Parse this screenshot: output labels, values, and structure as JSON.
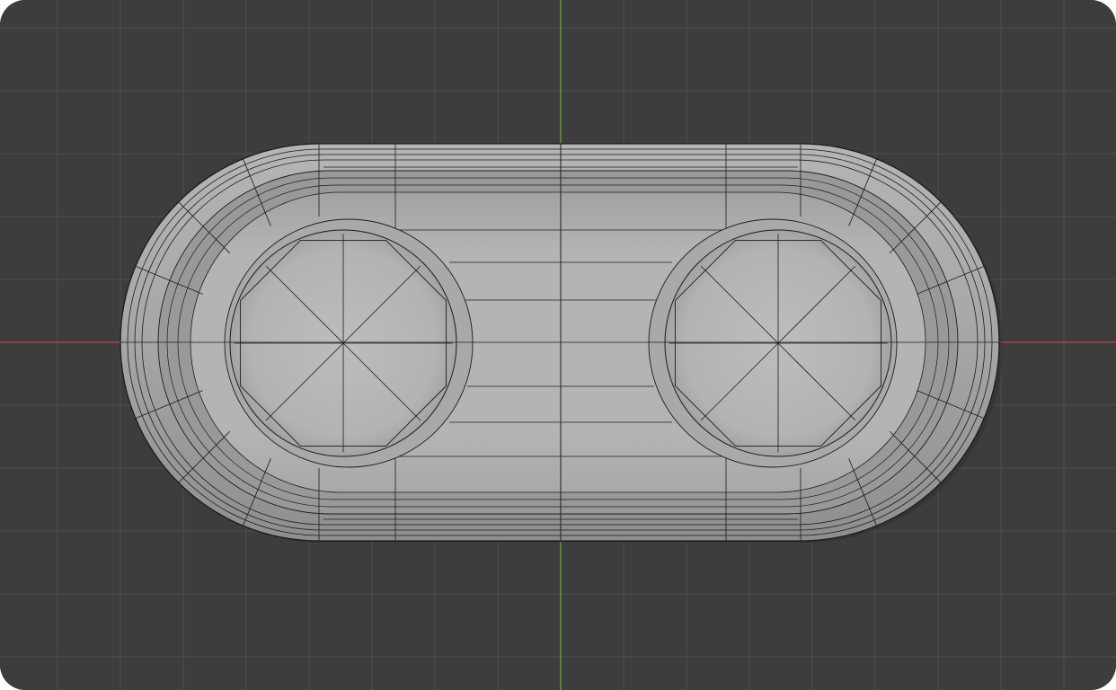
{
  "viewport": {
    "view": "top-orthographic",
    "shading": "solid",
    "overlays": {
      "wireframe": true,
      "floor_grid": true,
      "axis_x": true,
      "axis_y": true
    },
    "colors": {
      "background": "#3d3d3d",
      "grid_line": "#4e4e4e",
      "axis_x": "#c24a4a",
      "axis_y": "#74a83a",
      "mesh_surface": "#a4a4a4",
      "mesh_wire": "#1c1c1c"
    }
  },
  "scene": {
    "object_type": "mesh",
    "object_shape": "rounded-tray-with-two-circular-wells"
  }
}
